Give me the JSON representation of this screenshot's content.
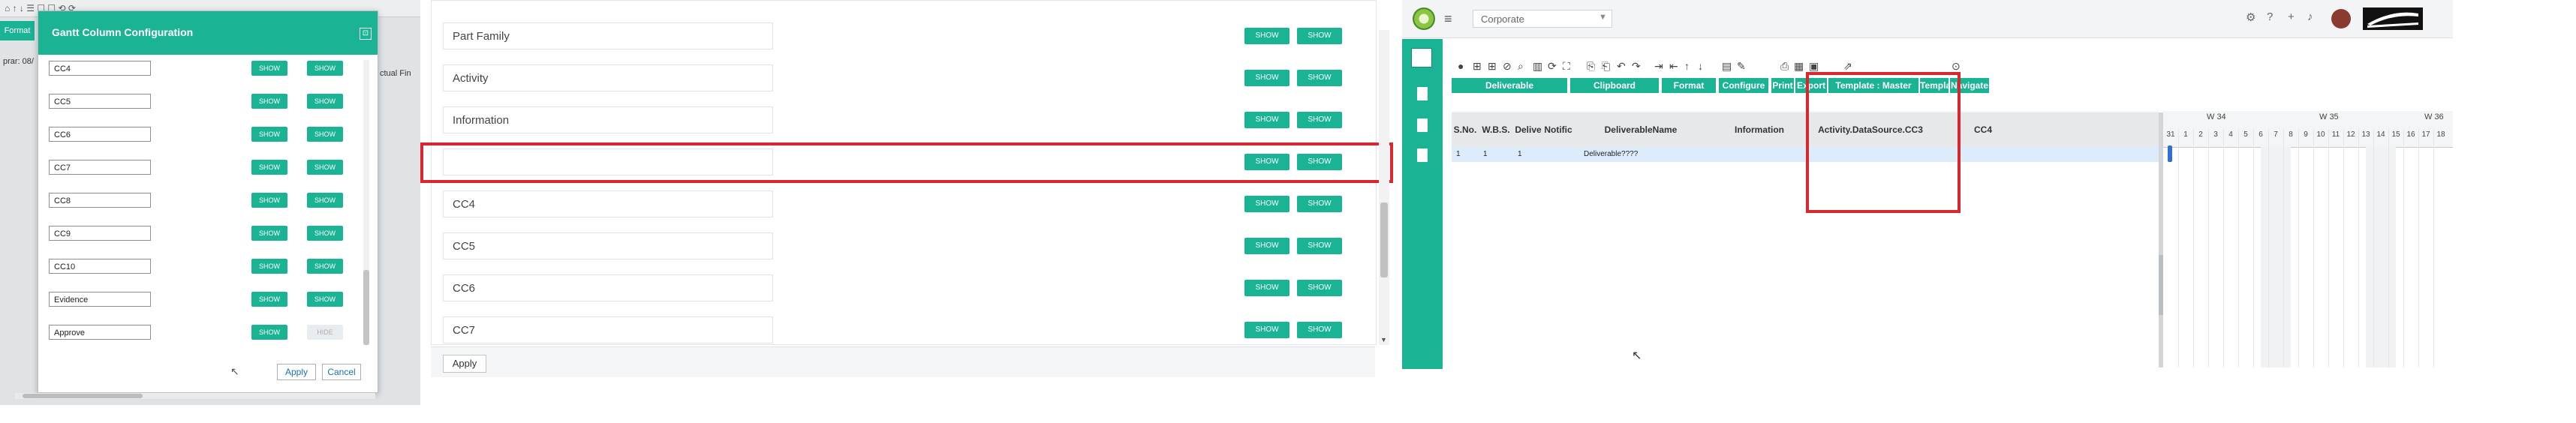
{
  "panelA": {
    "bg_toolbar_symbols": "⌂ ↑ ↓ ☰ ☐ ☐ ⟲ ⟳",
    "bg_format_tab": "Format",
    "bg_date_text": "prar: 08/",
    "bg_side_text": "ctual Fin",
    "dialog_title": "Gantt Column Configuration",
    "close_symbol": "⊡",
    "rows": [
      {
        "field": "CC4",
        "btn1": "SHOW",
        "btn2": "SHOW"
      },
      {
        "field": "CC5",
        "btn1": "SHOW",
        "btn2": "SHOW"
      },
      {
        "field": "CC6",
        "btn1": "SHOW",
        "btn2": "SHOW"
      },
      {
        "field": "CC7",
        "btn1": "SHOW",
        "btn2": "SHOW"
      },
      {
        "field": "CC8",
        "btn1": "SHOW",
        "btn2": "SHOW"
      },
      {
        "field": "CC9",
        "btn1": "SHOW",
        "btn2": "SHOW"
      },
      {
        "field": "CC10",
        "btn1": "SHOW",
        "btn2": "SHOW"
      },
      {
        "field": "Evidence",
        "btn1": "SHOW",
        "btn2": "SHOW"
      },
      {
        "field": "Approve",
        "btn1": "SHOW",
        "btn2": "HIDE"
      }
    ],
    "apply_label": "Apply",
    "cancel_label": "Cancel"
  },
  "panelB": {
    "rows": [
      {
        "field": "Part Family",
        "btn1": "SHOW",
        "btn2": "SHOW"
      },
      {
        "field": "Activity",
        "btn1": "SHOW",
        "btn2": "SHOW"
      },
      {
        "field": "Information",
        "btn1": "SHOW",
        "btn2": "SHOW"
      },
      {
        "field": "",
        "btn1": "SHOW",
        "btn2": "SHOW"
      },
      {
        "field": "CC4",
        "btn1": "SHOW",
        "btn2": "SHOW"
      },
      {
        "field": "CC5",
        "btn1": "SHOW",
        "btn2": "SHOW"
      },
      {
        "field": "CC6",
        "btn1": "SHOW",
        "btn2": "SHOW"
      },
      {
        "field": "CC7",
        "btn1": "SHOW",
        "btn2": "SHOW"
      }
    ],
    "apply_label": "Apply",
    "highlight_color": "#d9272e"
  },
  "panelC": {
    "org_select": "Corporate",
    "menu_symbol": "≡",
    "toolbar_groups": [
      "Deliverable",
      "Clipboard",
      "Format",
      "Configure",
      "Print",
      "Export",
      "Template : Master PGM",
      "Template",
      "Navigate"
    ],
    "columns": [
      "S.No.",
      "W.B.S.",
      "Delive",
      "Notific",
      "DeliverableName",
      "Information",
      "Activity.DataSource.CC3",
      "CC4"
    ],
    "row": {
      "sno": "1",
      "wbs": "1",
      "deliv": "1",
      "name": "Deliverable????"
    },
    "weeks": [
      "W 34",
      "W 35",
      "W 36"
    ],
    "days": [
      "31",
      "1",
      "2",
      "3",
      "4",
      "5",
      "6",
      "7",
      "8",
      "9",
      "10",
      "11",
      "12",
      "13",
      "14",
      "15",
      "16",
      "17",
      "18"
    ],
    "accent_color": "#1ab394"
  }
}
